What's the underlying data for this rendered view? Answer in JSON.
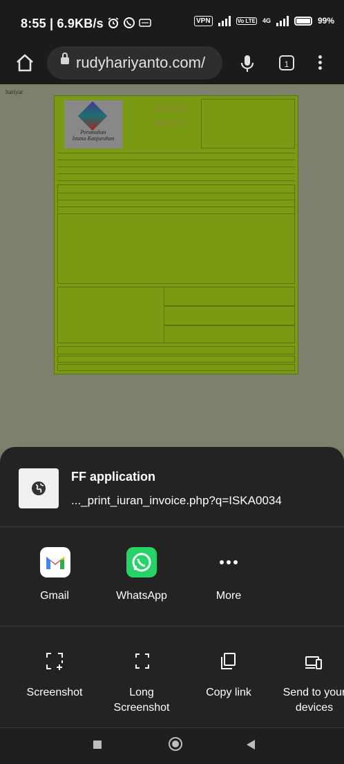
{
  "status_bar": {
    "left_text": "8:55 | 6.9KB/s",
    "vpn": "VPN",
    "lte": "Vo LTE",
    "net": "4G",
    "battery": "99%"
  },
  "browser": {
    "url": "rudyhariyanto.com/",
    "tab_count": "1"
  },
  "page": {
    "corner_text": "hariyar",
    "invoice_title": "IURAN NO",
    "invoice_no": "ISKA0034",
    "logo_text_1": "Perumahan",
    "logo_text_2": "Istana Kanjuruhan"
  },
  "share": {
    "app_title": "FF application",
    "app_url": "..._print_iuran_invoice.php?q=ISKA0034",
    "targets": [
      {
        "label": "Gmail",
        "icon": "gmail-icon"
      },
      {
        "label": "WhatsApp",
        "icon": "whatsapp-icon"
      },
      {
        "label": "More",
        "icon": "more-icon"
      }
    ],
    "actions": [
      {
        "label": "Screenshot",
        "icon": "screenshot-icon"
      },
      {
        "label": "Long Screenshot",
        "icon": "long-screenshot-icon"
      },
      {
        "label": "Copy link",
        "icon": "copy-link-icon"
      },
      {
        "label": "Send to your devices",
        "icon": "send-to-devices-icon"
      }
    ]
  },
  "colors": {
    "sheet_bg": "#232323",
    "whatsapp_green": "#25d366",
    "invoice_green": "#7a9a14"
  }
}
